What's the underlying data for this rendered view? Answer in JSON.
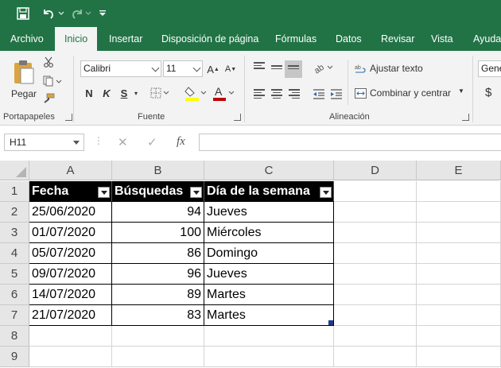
{
  "qat": {
    "save_icon": "save-icon",
    "undo_icon": "undo-icon",
    "redo_icon": "redo-icon",
    "customize_icon": "customize-qat-icon"
  },
  "tabs": [
    {
      "label": "Archivo",
      "active": false
    },
    {
      "label": "Inicio",
      "active": true
    },
    {
      "label": "Insertar",
      "active": false
    },
    {
      "label": "Disposición de página",
      "active": false
    },
    {
      "label": "Fórmulas",
      "active": false
    },
    {
      "label": "Datos",
      "active": false
    },
    {
      "label": "Revisar",
      "active": false
    },
    {
      "label": "Vista",
      "active": false
    },
    {
      "label": "Ayuda",
      "active": false
    }
  ],
  "ribbon": {
    "clipboard": {
      "paste_label": "Pegar",
      "group_label": "Portapapeles"
    },
    "font": {
      "font_name": "Calibri",
      "font_size": "11",
      "bold": "N",
      "italic": "K",
      "underline": "S",
      "group_label": "Fuente"
    },
    "alignment": {
      "wrap_text": "Ajustar texto",
      "merge_center": "Combinar y centrar",
      "group_label": "Alineación"
    },
    "number": {
      "format": "Gene",
      "currency": "$"
    }
  },
  "formula_bar": {
    "name_box": "H11",
    "cancel": "✕",
    "enter": "✓",
    "fx": "fx",
    "value": ""
  },
  "sheet": {
    "columns": [
      "A",
      "B",
      "C",
      "D",
      "E"
    ],
    "rows": [
      "1",
      "2",
      "3",
      "4",
      "5",
      "6",
      "7",
      "8",
      "9"
    ],
    "table_headers": [
      "Fecha",
      "Búsquedas",
      "Día de la semana"
    ],
    "table_rows": [
      [
        "25/06/2020",
        "94",
        "Jueves"
      ],
      [
        "01/07/2020",
        "100",
        "Miércoles"
      ],
      [
        "05/07/2020",
        "86",
        "Domingo"
      ],
      [
        "09/07/2020",
        "96",
        "Jueves"
      ],
      [
        "14/07/2020",
        "89",
        "Martes"
      ],
      [
        "21/07/2020",
        "83",
        "Martes"
      ]
    ]
  },
  "colors": {
    "excel_green": "#217346",
    "header_fill": "#000000",
    "font_color_bar": "#c00000",
    "highlight_bar": "#ffff00"
  }
}
